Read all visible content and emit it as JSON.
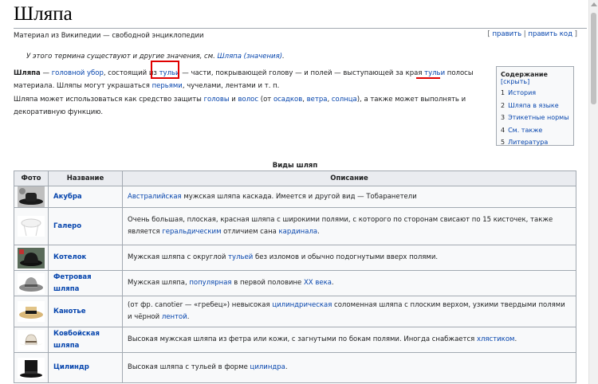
{
  "page": {
    "title": "Шляпа",
    "subtitle": "Материал из Википедии — свободной энциклопедии",
    "edit_links": {
      "open": "[ ",
      "edit": "править",
      "sep": " | ",
      "edit_code": "править код",
      "close": " ]"
    }
  },
  "hatnote": {
    "text": "У этого термина существуют и другие значения, см. ",
    "link": "Шляпа (значения)",
    "end": "."
  },
  "intro1": {
    "bold": "Шляпа",
    "t1": " — ",
    "l1": "головной убор",
    "t2": ", состоящий из ",
    "l2": "тульи",
    "t3": " — части, покрывающей голову — и полей — выступающей за края ",
    "l3": "тульи",
    "t4": " полосы материала. Шляпы могут украшаться ",
    "l4": "перьями",
    "t5": ", чучелами, лентами и т. п."
  },
  "intro2": {
    "t1": "Шляпа может использоваться как средство защиты ",
    "l1": "головы",
    "t2": " и ",
    "l2": "волос",
    "t3": " (от ",
    "l3": "осадков",
    "t4": ", ",
    "l4": "ветра",
    "t5": ", ",
    "l5": "солнца",
    "t6": "), а также может выполнять и декоративную функцию."
  },
  "toc": {
    "title": "Содержание",
    "toggle": "[скрыть]",
    "items": [
      {
        "num": "1",
        "label": "История"
      },
      {
        "num": "2",
        "label": "Шляпа в языке"
      },
      {
        "num": "3",
        "label": "Этикетные нормы"
      },
      {
        "num": "4",
        "label": "См. также"
      },
      {
        "num": "5",
        "label": "Литература"
      }
    ]
  },
  "table": {
    "caption": "Виды шляп",
    "headers": [
      "Фото",
      "Название",
      "Описание"
    ],
    "rows": [
      {
        "name": "Акубра",
        "d": [
          {
            "l": "Австралийская"
          },
          {
            "t": " мужская шляпа каскада. Имеется и другой вид — Тобаранетели"
          }
        ]
      },
      {
        "name": "Галеро",
        "d": [
          {
            "t": "Очень большая, плоская, красная шляпа с широкими полями, с которого по сторонам свисают по 15 кисточек, также является "
          },
          {
            "l": "геральдическим"
          },
          {
            "t": " отличием сана "
          },
          {
            "l": "кардинала"
          },
          {
            "t": "."
          }
        ]
      },
      {
        "name": "Котелок",
        "d": [
          {
            "t": "Мужская шляпа с округлой "
          },
          {
            "l": "тульей"
          },
          {
            "t": " без изломов и обычно подогнутыми вверх полями."
          }
        ]
      },
      {
        "name": "Фетровая шляпа",
        "d": [
          {
            "t": "Мужская шляпа, "
          },
          {
            "l": "популярная"
          },
          {
            "t": " в первой половине "
          },
          {
            "l": "XX века"
          },
          {
            "t": "."
          }
        ]
      },
      {
        "name": "Канотье",
        "d": [
          {
            "t": "(от фр. canotier — «гребец») невысокая "
          },
          {
            "l": "цилиндрическая"
          },
          {
            "t": " соломенная шляпа с плоским верхом, узкими твердыми полями и чёрной "
          },
          {
            "l": "лентой"
          },
          {
            "t": "."
          }
        ]
      },
      {
        "name": "Ковбойская шляпа",
        "d": [
          {
            "t": "Высокая мужская шляпа из фетра или кожи, с загнутыми по бокам полями. Иногда снабжается "
          },
          {
            "l": "хлястиком"
          },
          {
            "t": "."
          }
        ]
      },
      {
        "name": "Цилиндр",
        "d": [
          {
            "t": "Высокая шляпа с тульей в форме "
          },
          {
            "l": "цилиндра"
          },
          {
            "t": "."
          }
        ]
      }
    ]
  },
  "thumb_icons": [
    "akubra-hat-icon",
    "galero-hat-icon",
    "bowler-hat-icon",
    "fedora-hat-icon",
    "boater-hat-icon",
    "cowboy-hat-icon",
    "top-hat-icon"
  ],
  "colors": {
    "link": "#0645ad",
    "highlight": "#e00000",
    "border": "#a2a9b1"
  }
}
